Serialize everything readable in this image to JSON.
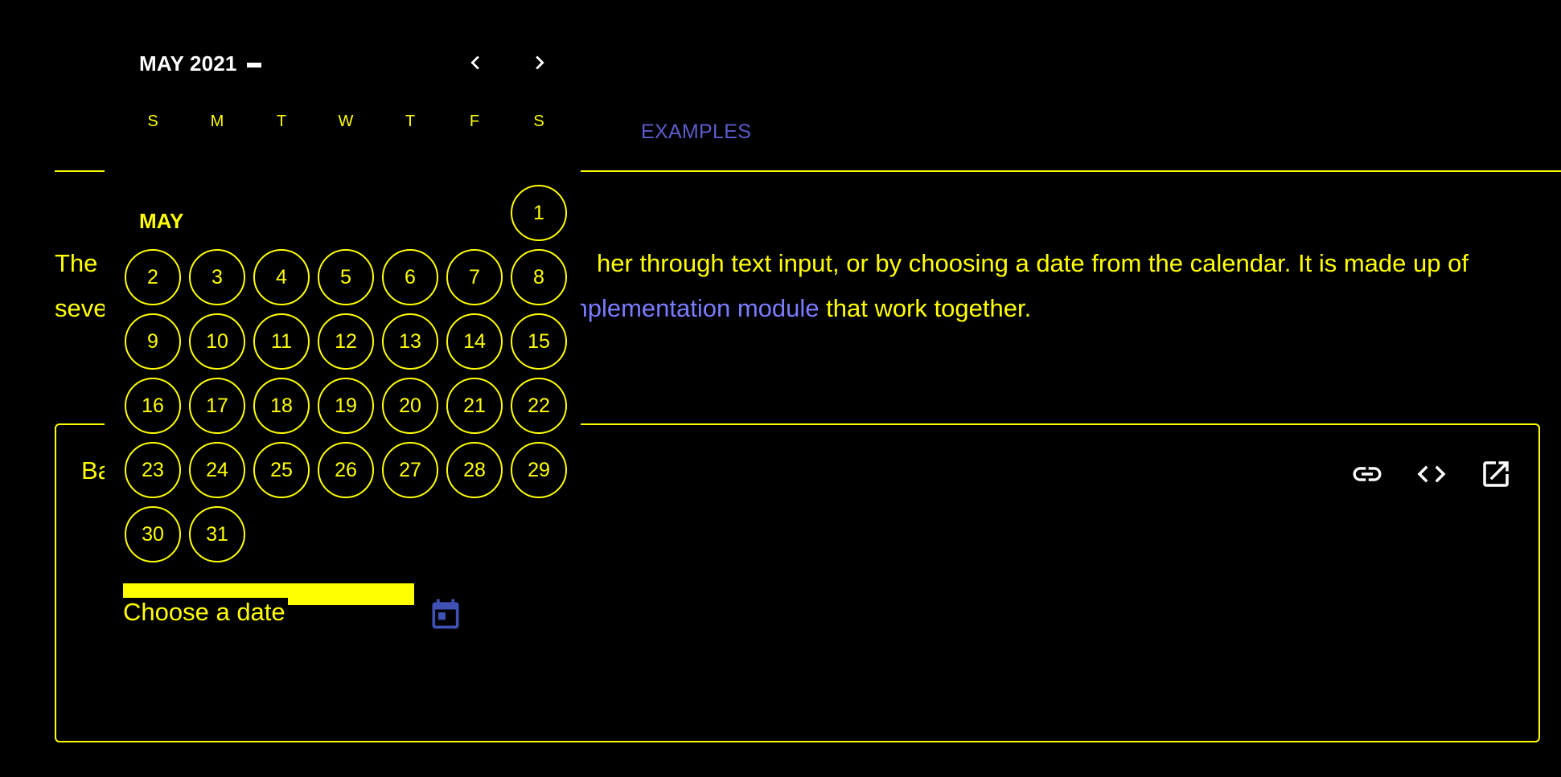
{
  "tabs": {
    "examples_label": "EXAMPLES"
  },
  "intro": {
    "part1": "The ",
    "part2": "her through text input, or by choosing a date from the calendar. It is made up of",
    "part3": "seve",
    "link_text": "nplementation module",
    "part4": " that work together."
  },
  "example": {
    "title": "Ba",
    "actions": [
      {
        "name": "link-icon"
      },
      {
        "name": "code-icon"
      },
      {
        "name": "open-in-new-icon"
      }
    ]
  },
  "date_input": {
    "label": "Choose a date",
    "value": "",
    "toggle_icon": "calendar-icon"
  },
  "calendar": {
    "period_label": "MAY 2021",
    "prev_icon": "chevron-left-icon",
    "next_icon": "chevron-right-icon",
    "weekdays": [
      "S",
      "M",
      "T",
      "W",
      "T",
      "F",
      "S"
    ],
    "month_label": "MAY",
    "first_weekday_index": 6,
    "days": [
      "1",
      "2",
      "3",
      "4",
      "5",
      "6",
      "7",
      "8",
      "9",
      "10",
      "11",
      "12",
      "13",
      "14",
      "15",
      "16",
      "17",
      "18",
      "19",
      "20",
      "21",
      "22",
      "23",
      "24",
      "25",
      "26",
      "27",
      "28",
      "29",
      "30",
      "31"
    ]
  },
  "colors": {
    "background": "#000000",
    "foreground": "#ffff00",
    "accent": "#5c5ccc",
    "link": "#7b7bff",
    "period_text": "#ffffff"
  }
}
